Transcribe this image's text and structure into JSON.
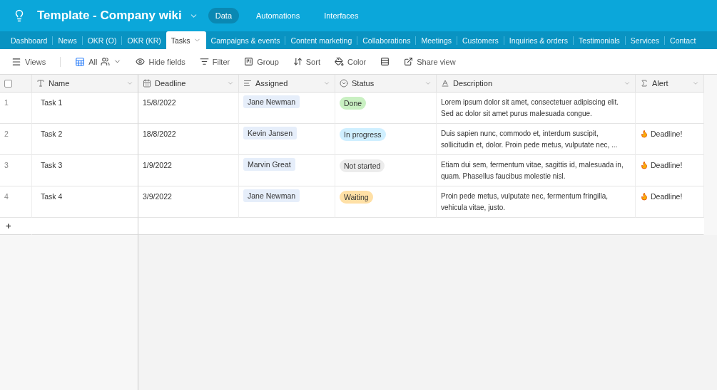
{
  "app": {
    "title": "Template - Company wiki",
    "nav": [
      {
        "label": "Data",
        "selected": true
      },
      {
        "label": "Automations",
        "selected": false
      },
      {
        "label": "Interfaces",
        "selected": false
      }
    ]
  },
  "tables": [
    {
      "label": "Dashboard",
      "selected": false
    },
    {
      "label": "News",
      "selected": false
    },
    {
      "label": "OKR (O)",
      "selected": false
    },
    {
      "label": "OKR (KR)",
      "selected": false
    },
    {
      "label": "Tasks",
      "selected": true
    },
    {
      "label": "Campaigns & events",
      "selected": false
    },
    {
      "label": "Content marketing",
      "selected": false
    },
    {
      "label": "Collaborations",
      "selected": false
    },
    {
      "label": "Meetings",
      "selected": false
    },
    {
      "label": "Customers",
      "selected": false
    },
    {
      "label": "Inquiries & orders",
      "selected": false
    },
    {
      "label": "Testimonials",
      "selected": false
    },
    {
      "label": "Services",
      "selected": false
    },
    {
      "label": "Contact",
      "selected": false
    }
  ],
  "toolbar": {
    "views": "Views",
    "view": "All",
    "items": [
      {
        "kind": "hide",
        "label": "Hide fields"
      },
      {
        "kind": "filter",
        "label": "Filter"
      },
      {
        "kind": "group",
        "label": "Group"
      },
      {
        "kind": "sort",
        "label": "Sort"
      },
      {
        "kind": "color",
        "label": "Color"
      },
      {
        "kind": "height"
      },
      {
        "kind": "share",
        "label": "Share view"
      }
    ]
  },
  "table": {
    "select_all": {
      "checked": false
    },
    "columns": [
      {
        "kind": "text",
        "label": "Name"
      },
      {
        "kind": "date",
        "label": "Deadline"
      },
      {
        "kind": "link",
        "label": "Assigned"
      },
      {
        "kind": "select",
        "label": "Status"
      },
      {
        "kind": "longtext",
        "label": "Description"
      },
      {
        "kind": "formula",
        "label": "Alert"
      }
    ],
    "rows": [
      {
        "number": "1",
        "name": "Task 1",
        "deadline": "15/8/2022",
        "assigned": "Jane Newman",
        "status": {
          "label": "Done",
          "color": "#c9f0c2"
        },
        "description": "Lorem ipsum dolor sit amet, consectetuer adipiscing elit. Sed ac dolor sit amet purus malesuada congue."
      },
      {
        "number": "2",
        "name": "Task 2",
        "deadline": "18/8/2022",
        "assigned": "Kevin Jansen",
        "status": {
          "label": "In progress",
          "color": "#cfefff"
        },
        "description": "Duis sapien nunc, commodo et, interdum suscipit, sollicitudin et, dolor. Proin pede metus, vulputate nec, ...",
        "alert": "Deadline!"
      },
      {
        "number": "3",
        "name": "Task 3",
        "deadline": "1/9/2022",
        "assigned": "Marvin Great",
        "status": {
          "label": "Not started",
          "color": "#ececec"
        },
        "description": "Etiam dui sem, fermentum vitae, sagittis id, malesuada in, quam. Phasellus faucibus molestie nisl.",
        "alert": "Deadline!"
      },
      {
        "number": "4",
        "name": "Task 4",
        "deadline": "3/9/2022",
        "assigned": "Jane Newman",
        "status": {
          "label": "Waiting",
          "color": "#ffe0a6"
        },
        "description": "Proin pede metus, vulputate nec, fermentum fringilla, vehicula vitae, justo.",
        "alert": "Deadline!"
      }
    ],
    "add_row": "+"
  }
}
